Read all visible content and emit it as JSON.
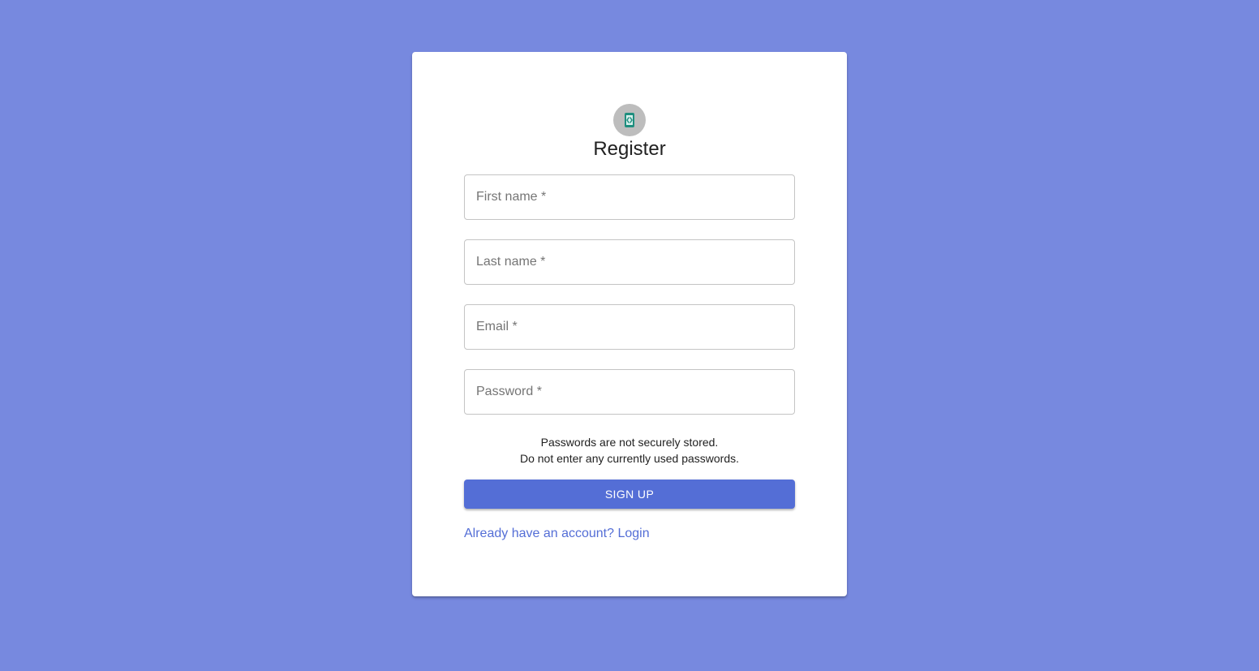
{
  "colors": {
    "background": "#7789DF",
    "card": "#FFFFFF",
    "accent": "#546ED6",
    "avatar_bg": "#BDBDBD",
    "icon_teal": "#1E8E7E"
  },
  "header": {
    "icon": "app-logo-icon",
    "title": "Register"
  },
  "form": {
    "first_name": {
      "placeholder": "First name *",
      "value": ""
    },
    "last_name": {
      "placeholder": "Last name *",
      "value": ""
    },
    "email": {
      "placeholder": "Email *",
      "value": ""
    },
    "password": {
      "placeholder": "Password *",
      "value": ""
    }
  },
  "notice": {
    "line1": "Passwords are not securely stored.",
    "line2": "Do not enter any currently used passwords."
  },
  "actions": {
    "signup_label": "SIGN UP",
    "login_link": "Already have an account? Login"
  }
}
